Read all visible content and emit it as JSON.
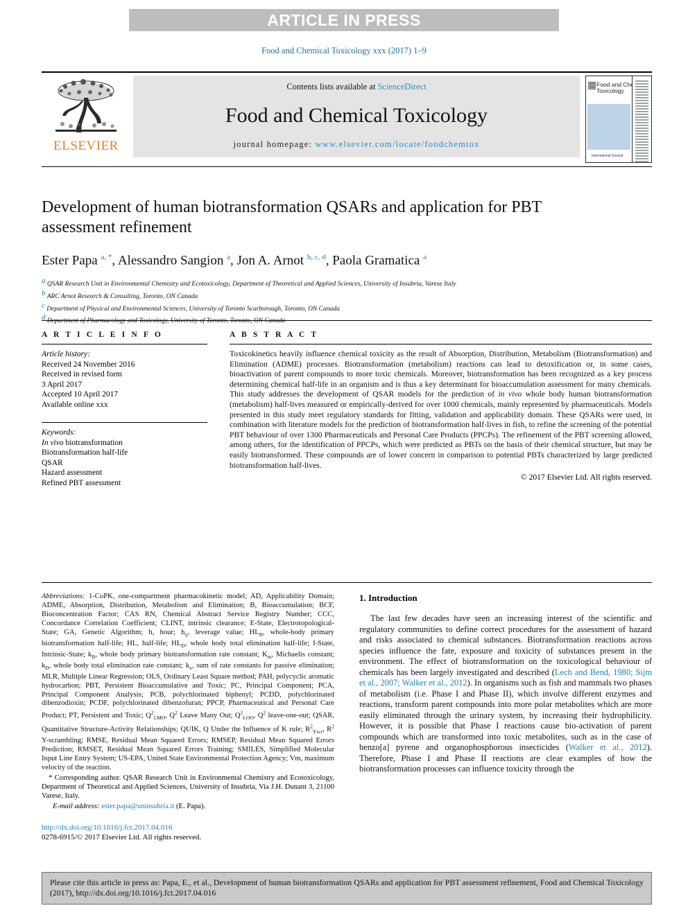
{
  "banner": {
    "label": "ARTICLE IN PRESS"
  },
  "running_head": "Food and Chemical Toxicology xxx (2017) 1–9",
  "masthead": {
    "publisher": "ELSEVIER",
    "contents_prefix": "Contents lists available at ",
    "contents_link": "ScienceDirect",
    "journal_title": "Food and Chemical Toxicology",
    "homepage_prefix": "journal homepage: ",
    "homepage_url": "www.elsevier.com/locate/foodchemtox",
    "cover_title": "Food and Chemical Toxicology",
    "cover_footer": "International Journal"
  },
  "article": {
    "title": "Development of human biotransformation QSARs and application for PBT assessment refinement",
    "authors_html": "Ester Papa <sup>a, *</sup>, Alessandro Sangion <sup>a</sup>, Jon A. Arnot <sup>b, c, d</sup>, Paola Gramatica <sup>a</sup>",
    "affiliations": [
      "a QSAR Research Unit in Environmental Chemistry and Ecotoxicology, Department of Theoretical and Applied Sciences, University of Insubria, Varese Italy",
      "b ARC Arnot Research & Consulting, Toronto, ON Canada",
      "c Department of Physical and Environmental Sciences, University of Toronto Scarborough, Toronto, ON Canada",
      "d Department of Pharmacology and Toxicology, University of Toronto, Toronto, ON Canada"
    ]
  },
  "article_info": {
    "heading": "A R T I C L E  I N F O",
    "history_label": "Article history:",
    "history": [
      "Received 24 November 2016",
      "Received in revised form",
      "3 April 2017",
      "Accepted 10 April 2017",
      "Available online xxx"
    ],
    "keywords_label": "Keywords:",
    "keywords": [
      "In vivo biotransformation",
      "Biotransformation half-life",
      "QSAR",
      "Hazard assessment",
      "Refined PBT assessment"
    ]
  },
  "abstract": {
    "heading": "A B S T R A C T",
    "text": "Toxicokinetics heavily influence chemical toxicity as the result of Absorption, Distribution, Metabolism (Biotransformation) and Elimination (ADME) processes. Biotransformation (metabolism) reactions can lead to detoxification or, in some cases, bioactivation of parent compounds to more toxic chemicals. Moreover, biotransformation has been recognized as a key process determining chemical half-life in an organism and is thus a key determinant for bioaccumulation assessment for many chemicals. This study addresses the development of QSAR models for the prediction of in vivo whole body human biotransformation (metabolism) half-lives measured or empirically-derived for over 1000 chemicals, mainly represented by pharmaceuticals. Models presented in this study meet regulatory standards for fitting, validation and applicability domain. These QSARs were used, in combination with literature models for the prediction of biotransformation half-lives in fish, to refine the screening of the potential PBT behaviour of over 1300 Pharmaceuticals and Personal Care Products (PPCPs). The refinement of the PBT screening allowed, among others, for the identification of PPCPs, which were predicted as PBTs on the basis of their chemical structure, but may be easily biotransformed. These compounds are of lower concern in comparison to potential PBTs characterized by large predicted biotransformation half-lives.",
    "copyright": "© 2017 Elsevier Ltd. All rights reserved."
  },
  "footnotes": {
    "abbreviations_label": "Abbreviations:",
    "abbreviations_text": " 1-CoPK, one-compartment pharmacokinetic model; AD, Applicability Domain; ADME, Absorption, Distribution, Metabolism and Elimination; B, Bioaccumulation; BCF, Bioconcentration Factor; CAS RN, Chemical Abstract Service Registry Number; CCC, Concordance Correlation Coefficient; CLINT, intrinsic clearance; E-State, Electrotopological-State; GA, Genetic Algorithm; h, hour; hij, leverage value; HLB, whole-body primary biotransformation half-life; HL, half-life; HLD, whole body total elimination half-life; I-State, Intrinsic-State; kB, whole body primary biotransformation rate constant; Km, Michaelis constant; kD, whole body total elimination rate constant; kx, sum of rate constants for passive elimination; MLR, Multiple Linear Regression; OLS, Ordinary Least Square method; PAH, polycyclic aromatic hydrocarbon; PBT, Persistent Bioaccumulative and Toxic; PC, Principal Component; PCA, Principal Component Analysis; PCB, polychlorinated biphenyl; PCDD, polychlorinated dibenzodioxin; PCDF, polychlorinated dibenzofuran; PPCP, Pharmaceutical and Personal Care Product; PT, Persistent and Toxic; Q2LMO, Q2 Leave Many Out; Q2LOO, Q2 leave-one-out; QSAR, Quantitative Structure-Activity Relationships; QUIK, Q Under the Influence of K rule; R2Yscr, R2 Y-scrambling; RMSE, Residual Mean Squared Errors; RMSEP, Residual Mean Squared Errors Prediction; RMSET, Residual Mean Squared Errors Training; SMILES, Simplified Molecular Input Line Entry System; US-EPA, United State Environmental Protection Agency; Vm, maximum velocity of the reaction.",
    "corresponding": "* Corresponding author. QSAR Research Unit in Environmental Chemistry and Ecotoxicology, Department of Theoretical and Applied Sciences, University of Insubria, Via J.H. Dunant 3, 21100 Varese, Italy.",
    "email_label": "E-mail address:",
    "email_address": "ester.papa@uninsubria.it",
    "email_owner": "(E. Papa).",
    "doi_url": "http://dx.doi.org/10.1016/j.fct.2017.04.016",
    "issn_line": "0278-6915/© 2017 Elsevier Ltd. All rights reserved."
  },
  "introduction": {
    "heading": "1. Introduction",
    "paragraph_1_a": "The last few decades have seen an increasing interest of the scientific and regulatory communities to define correct procedures for the assessment of hazard and risks associated to chemical substances. Biotransformation reactions across species influence the fate, exposure and toxicity of substances present in the environment. The effect of biotransformation on the toxicological behaviour of chemicals has been largely investigated and described (",
    "citation_1": "Lech and Bend, 1980; Sijm et al., 2007; Walker et al., 2012",
    "paragraph_1_b": "). In organisms such as fish and mammals two phases of metabolism (i.e. Phase I and Phase II), which involve different enzymes and reactions, transform parent compounds into more polar metabolites which are more easily eliminated through the urinary system, by increasing their hydrophilicity. However, it is possible that Phase I reactions cause bio-activation of parent compounds which are transformed into toxic metabolites, such as in the case of benzo[a] pyrene and organophosphorous insecticides (",
    "citation_2": "Walker et al., 2012",
    "paragraph_1_c": "). Therefore, Phase I and Phase II reactions are clear examples of how the biotransformation processes can influence toxicity through the"
  },
  "cite_box": {
    "text": "Please cite this article in press as: Papa, E., et al., Development of human biotransformation QSARs and application for PBT assessment refinement, Food and Chemical Toxicology (2017), http://dx.doi.org/10.1016/j.fct.2017.04.016"
  },
  "colors": {
    "banner_bg": "#bdbdbd",
    "link_blue": "#1a7fc1",
    "elsevier_orange": "#ef7c20",
    "masthead_grey": "#e4e4e4",
    "cite_box_bg": "#c9c9c9"
  }
}
